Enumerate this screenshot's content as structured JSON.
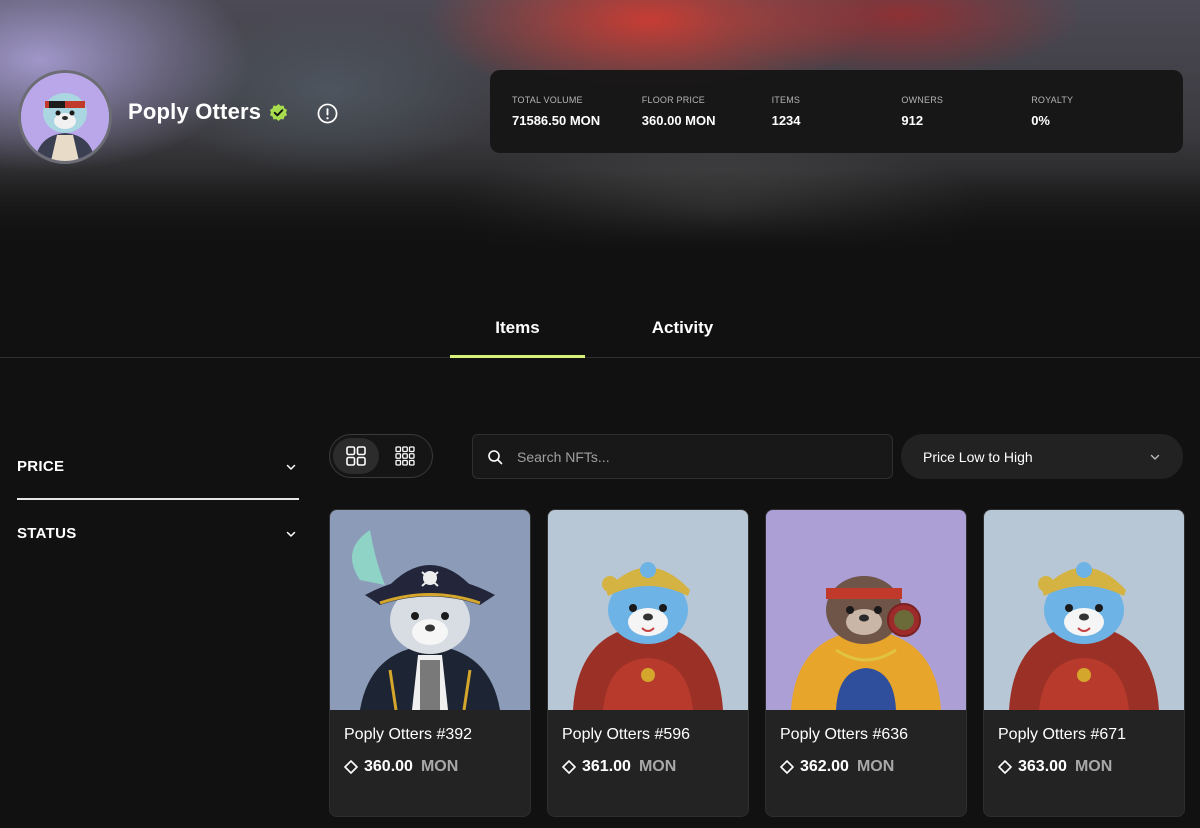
{
  "collection": {
    "name": "Poply Otters"
  },
  "stats": [
    {
      "label": "TOTAL VOLUME",
      "value": "71586.50 MON"
    },
    {
      "label": "FLOOR PRICE",
      "value": "360.00 MON"
    },
    {
      "label": "ITEMS",
      "value": "1234"
    },
    {
      "label": "OWNERS",
      "value": "912"
    },
    {
      "label": "ROYALTY",
      "value": "0%"
    }
  ],
  "tabs": [
    {
      "label": "Items",
      "active": true
    },
    {
      "label": "Activity",
      "active": false
    }
  ],
  "filters": [
    {
      "label": "PRICE"
    },
    {
      "label": "STATUS"
    }
  ],
  "search": {
    "placeholder": "Search NFTs..."
  },
  "sort": {
    "selected": "Price Low to High"
  },
  "colors": {
    "accent": "#d9f07b",
    "verified": "#a7dc4f"
  },
  "cards": [
    {
      "name": "Poply Otters #392",
      "price": "360.00",
      "currency": "MON",
      "bg": "#8c9cb8"
    },
    {
      "name": "Poply Otters #596",
      "price": "361.00",
      "currency": "MON",
      "bg": "#b8c7d6"
    },
    {
      "name": "Poply Otters #636",
      "price": "362.00",
      "currency": "MON",
      "bg": "#ab9fd6"
    },
    {
      "name": "Poply Otters #671",
      "price": "363.00",
      "currency": "MON",
      "bg": "#b8c7d6"
    }
  ]
}
